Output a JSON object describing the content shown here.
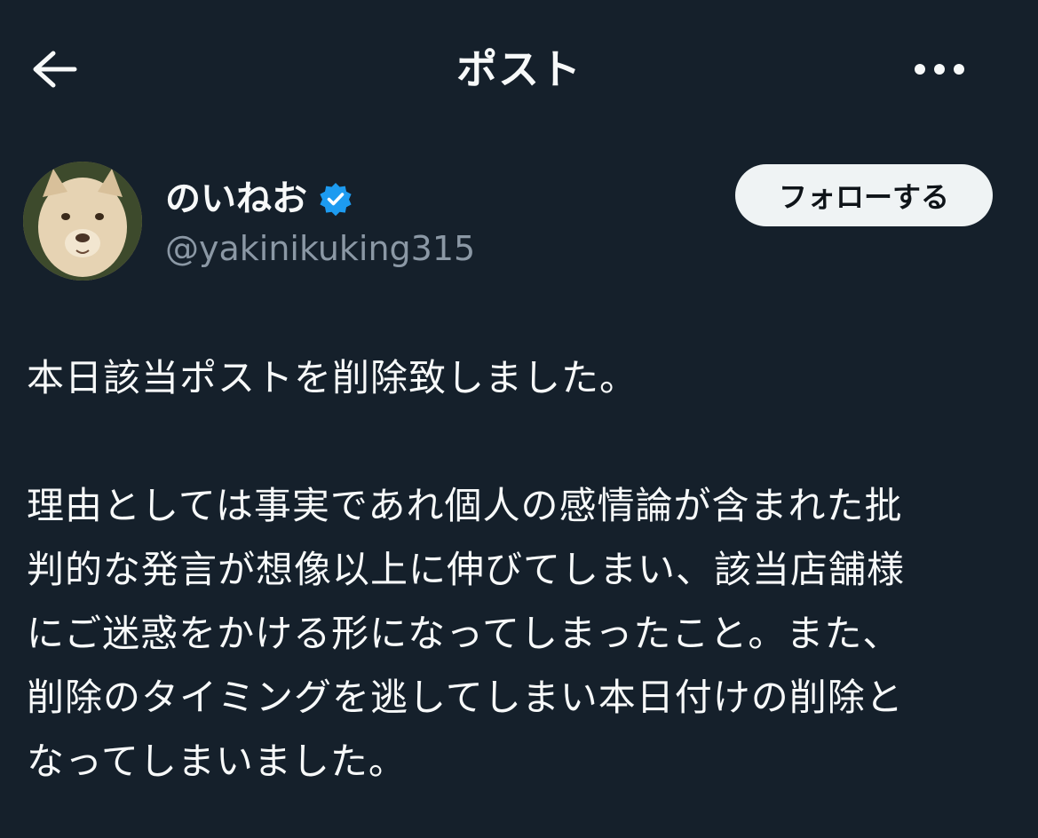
{
  "header": {
    "back_icon": "arrow-left-icon",
    "title": "ポスト",
    "more_icon": "more-horizontal-icon"
  },
  "author": {
    "display_name": "のいねお",
    "verified_icon": "verified-badge-icon",
    "verified_color": "#1d9bf0",
    "handle": "@yakinikuking315",
    "follow_label": "フォローする"
  },
  "post": {
    "line1": "本日該当ポストを削除致しました。",
    "line2": "理由としては事実であれ個人の感情論が含まれた批",
    "line3": "判的な発言が想像以上に伸びてしまい、該当店舗様",
    "line4": "にご迷惑をかける形になってしまったこと。また、",
    "line5": "削除のタイミングを逃してしまい本日付けの削除と",
    "line6": "なってしまいました。"
  },
  "colors": {
    "background": "#15202b",
    "text": "#f7f9f9",
    "secondary_text": "#8b98a5",
    "button_bg": "#eff3f4"
  }
}
